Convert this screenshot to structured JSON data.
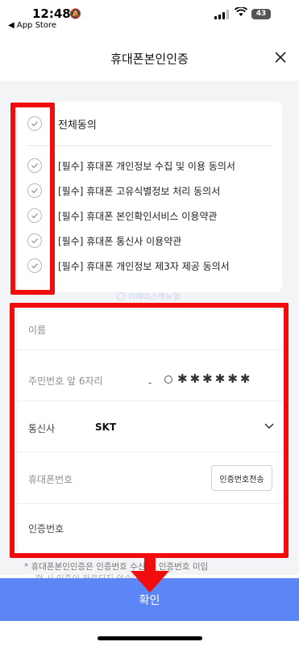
{
  "status_bar": {
    "time": "12:48",
    "back_label": "◀ App Store",
    "battery": "43"
  },
  "header": {
    "title": "휴대폰본인인증"
  },
  "agreements": {
    "all_label": "전체동의",
    "items": [
      {
        "label": "[필수] 휴대폰 개인정보 수집 및 이용 동의서"
      },
      {
        "label": "[필수] 휴대폰 고유식별정보 처리 동의서"
      },
      {
        "label": "[필수] 휴대폰 본인확인서비스 이용약관"
      },
      {
        "label": "[필수] 휴대폰 통신사 이용약관"
      },
      {
        "label": "[필수] 휴대폰 개인정보 제3자 제공 동의서"
      }
    ]
  },
  "watermark": "이페이스매뉴얼",
  "form": {
    "name_label": "이름",
    "rrn_label": "주민번호 앞 6자리",
    "rrn_dash": "-",
    "rrn_mask": "••••••",
    "carrier_label": "통신사",
    "carrier_value": "SKT",
    "phone_label": "휴대폰번호",
    "send_button": "인증번호전송",
    "code_label": "인증번호"
  },
  "notice": "* 휴대폰본인인증은 인증번호 수신 후 인증번호 미입",
  "notice_line2": "력 시 인증이 완료되지 않습니다.",
  "confirm_button": "확인",
  "colors": {
    "primary": "#5c86f5",
    "annotation": "#f20d0d"
  }
}
